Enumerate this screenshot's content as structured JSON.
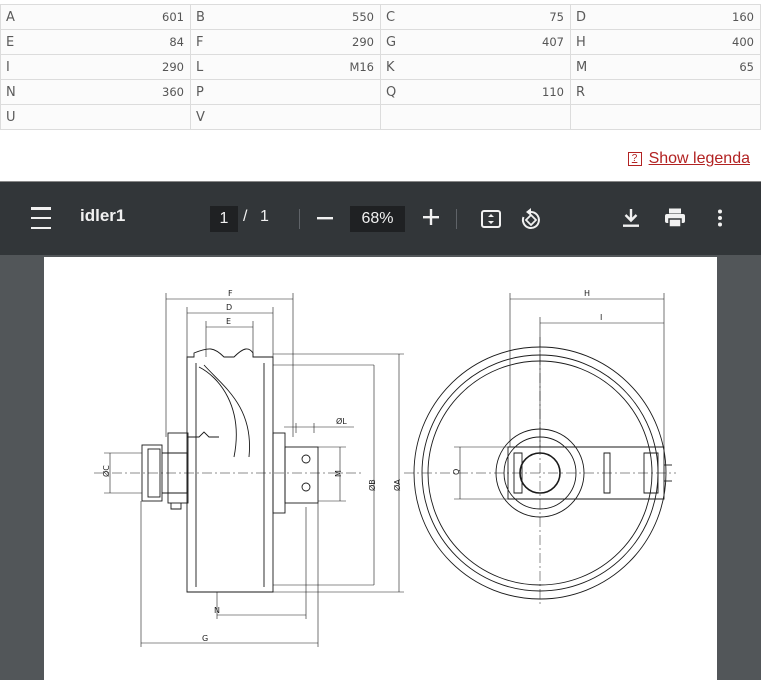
{
  "dimensions": {
    "rows": [
      [
        {
          "key": "A",
          "value": "601"
        },
        {
          "key": "B",
          "value": "550"
        },
        {
          "key": "C",
          "value": "75"
        },
        {
          "key": "D",
          "value": "160"
        }
      ],
      [
        {
          "key": "E",
          "value": "84"
        },
        {
          "key": "F",
          "value": "290"
        },
        {
          "key": "G",
          "value": "407"
        },
        {
          "key": "H",
          "value": "400"
        }
      ],
      [
        {
          "key": "I",
          "value": "290"
        },
        {
          "key": "L",
          "value": "M16"
        },
        {
          "key": "K",
          "value": ""
        },
        {
          "key": "M",
          "value": "65"
        }
      ],
      [
        {
          "key": "N",
          "value": "360"
        },
        {
          "key": "P",
          "value": ""
        },
        {
          "key": "Q",
          "value": "110"
        },
        {
          "key": "R",
          "value": ""
        }
      ],
      [
        {
          "key": "U",
          "value": ""
        },
        {
          "key": "V",
          "value": ""
        },
        {
          "key": "",
          "value": ""
        },
        {
          "key": "",
          "value": ""
        }
      ]
    ]
  },
  "legend_link": {
    "label": "Show legenda",
    "icon": "question-box-icon"
  },
  "viewer": {
    "title": "idler1",
    "page_current": "1",
    "page_separator": "/",
    "page_total": "1",
    "zoom": "68%",
    "icons": {
      "menu": "menu-icon",
      "zoom_out": "minus-icon",
      "zoom_in": "plus-icon",
      "fit": "fit-page-icon",
      "rotate": "rotate-icon",
      "download": "download-icon",
      "print": "print-icon",
      "more": "more-vert-icon"
    }
  },
  "drawing": {
    "labels": {
      "F": "F",
      "D": "D",
      "E": "E",
      "H": "H",
      "I": "I",
      "L": "ØL",
      "C": "ØC",
      "M": "M",
      "B": "ØB",
      "A": "ØA",
      "Q": "Q",
      "N": "N",
      "G": "G"
    }
  },
  "colors": {
    "toolbar": "#323639",
    "viewer_bg": "#525659",
    "link": "#b22222"
  }
}
